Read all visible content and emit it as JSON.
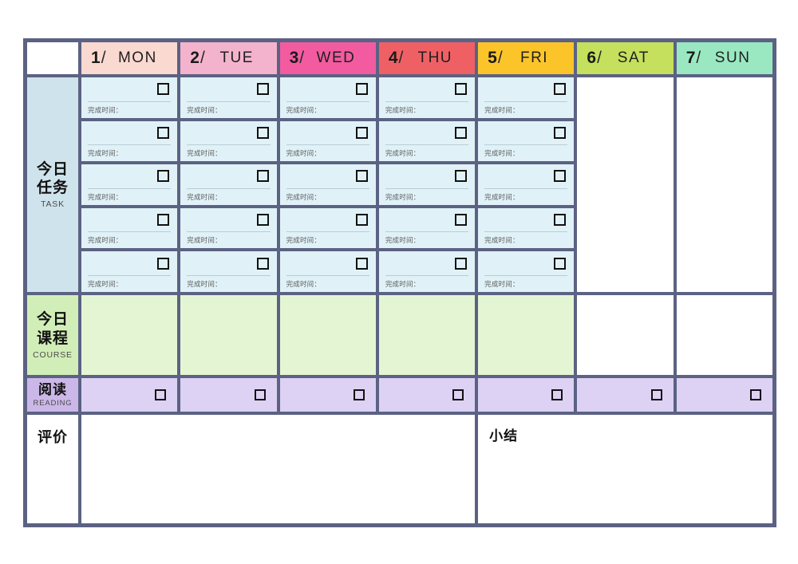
{
  "planner": {
    "header": {
      "corner_label": "",
      "days": [
        {
          "num": "1",
          "sep": "/",
          "dow": "MON",
          "color": "#fad9d0"
        },
        {
          "num": "2",
          "sep": "/",
          "dow": "TUE",
          "color": "#f4b3cd"
        },
        {
          "num": "3",
          "sep": "/",
          "dow": "WED",
          "color": "#f25ba0"
        },
        {
          "num": "4",
          "sep": "/",
          "dow": "THU",
          "color": "#ef6065"
        },
        {
          "num": "5",
          "sep": "/",
          "dow": "FRI",
          "color": "#fbc52a"
        },
        {
          "num": "6",
          "sep": "/",
          "dow": "SAT",
          "color": "#c5e05d"
        },
        {
          "num": "7",
          "sep": "/",
          "dow": "SUN",
          "color": "#9ae8c2"
        }
      ]
    },
    "rows": {
      "task": {
        "label_cn": "今日\n任务",
        "label_cn_line1": "今日",
        "label_cn_line2": "任务",
        "label_en": "TASK",
        "label_bg": "#cfe3ec",
        "cell_bg": "#e0f2f7",
        "slots": 5,
        "days_covered": 5,
        "time_label": "完成时间：",
        "checkbox": "checkbox-empty"
      },
      "course": {
        "label_cn_line1": "今日",
        "label_cn_line2": "课程",
        "label_en": "COURSE",
        "label_bg": "#d2eeb8",
        "cell_bg": "#e4f5d4",
        "days_covered": 5
      },
      "reading": {
        "label_cn": "阅读",
        "label_en": "READING",
        "label_bg": "#cbb8e8",
        "cell_bg": "#ddd2f4",
        "days_covered": 7,
        "checkbox": "checkbox-empty"
      },
      "evaluation": {
        "label_cn": "评价",
        "summary_cn": "小结",
        "cell_bg": "#ffffff"
      }
    },
    "colors": {
      "border": "#5b6283",
      "frame": "#5b6283",
      "checkbox": "#111111",
      "rule": "#b9cdd6"
    }
  }
}
